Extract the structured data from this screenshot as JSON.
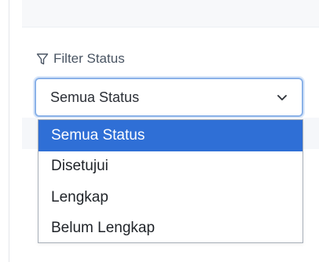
{
  "filter": {
    "label": "Filter Status",
    "icon": "filter-icon",
    "selected_value": "Semua Status",
    "options": [
      {
        "label": "Semua Status",
        "selected": true
      },
      {
        "label": "Disetujui",
        "selected": false
      },
      {
        "label": "Lengkap",
        "selected": false
      },
      {
        "label": "Belum Lengkap",
        "selected": false
      }
    ]
  },
  "colors": {
    "accent": "#2f6fd6",
    "focus_border": "#8bb2e8"
  }
}
